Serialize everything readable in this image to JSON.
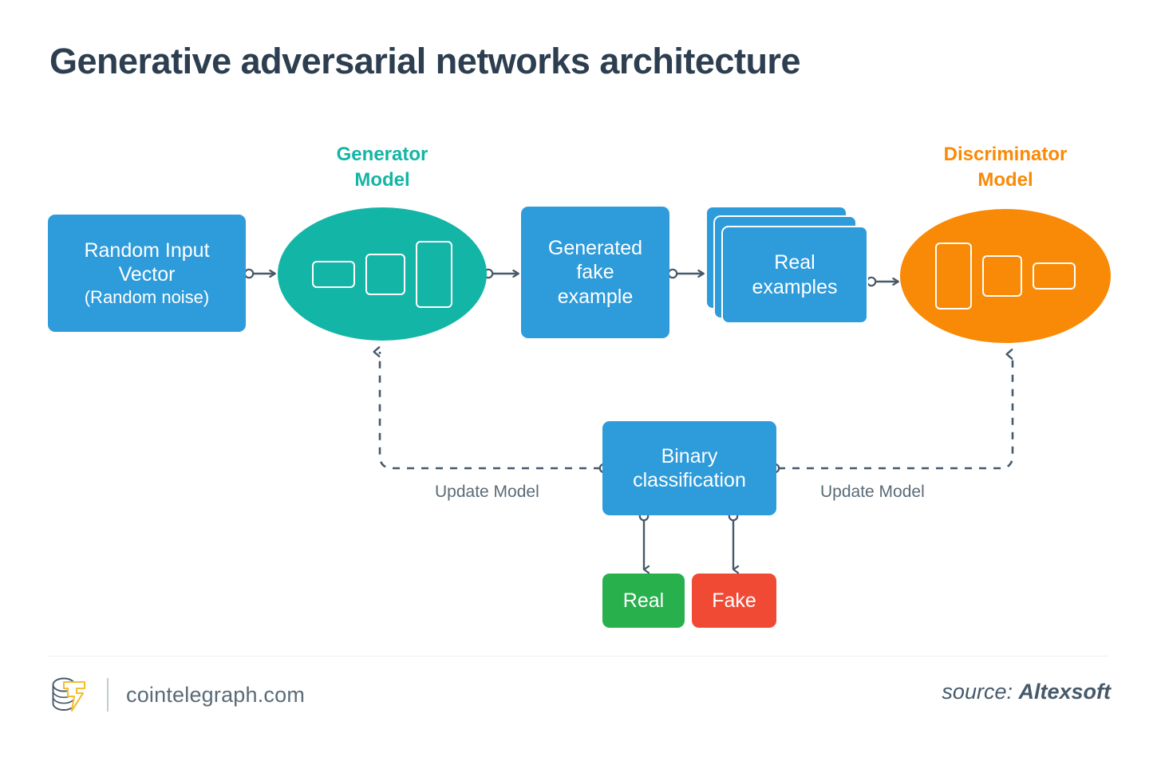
{
  "page": {
    "title": "Generative adversarial networks architecture",
    "background_color": "#ffffff"
  },
  "colors": {
    "blue": "#2E9BDB",
    "teal": "#13B5A6",
    "orange": "#F98A07",
    "green": "#27B04C",
    "red": "#F04A35",
    "title_text": "#2c3e50",
    "muted_text": "#5A6B78",
    "edge": "#46596A"
  },
  "nodes": {
    "random_input": {
      "line1": "Random Input",
      "line2": "Vector",
      "line3": "(Random noise)"
    },
    "generator": {
      "label": "Generator\nModel",
      "layers": [
        "small",
        "medium",
        "large"
      ]
    },
    "generated_fake": {
      "line1": "Generated",
      "line2": "fake",
      "line3": "example"
    },
    "real_examples": {
      "line1": "Real",
      "line2": "examples",
      "card_count": 3
    },
    "discriminator": {
      "label": "Discriminator\nModel",
      "layers": [
        "large",
        "medium",
        "small"
      ]
    },
    "binary_classification": {
      "line1": "Binary",
      "line2": "classification"
    },
    "real_outcome": {
      "label": "Real"
    },
    "fake_outcome": {
      "label": "Fake"
    }
  },
  "edges": {
    "update_model_left": "Update Model",
    "update_model_right": "Update Model"
  },
  "footer": {
    "brand": "cointelegraph.com",
    "logo_icon": "cointelegraph-coin-bolt-icon",
    "source_prefix": "source:",
    "source_name": "Altexsoft"
  }
}
